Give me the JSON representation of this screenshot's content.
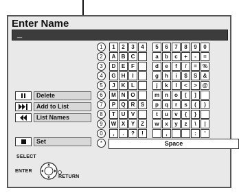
{
  "title": "Enter Name",
  "name_value": "_",
  "keyboard": {
    "rows": [
      {
        "index": "1",
        "keys": [
          "1",
          "2",
          "3",
          "4",
          "5",
          "6",
          "7",
          "8",
          "9",
          "0"
        ]
      },
      {
        "index": "2",
        "keys": [
          "A",
          "B",
          "C",
          "",
          "a",
          "b",
          "c",
          "+",
          "-",
          "="
        ]
      },
      {
        "index": "3",
        "keys": [
          "D",
          "E",
          "F",
          "",
          "d",
          "e",
          "f",
          "/",
          "=",
          "%"
        ]
      },
      {
        "index": "4",
        "keys": [
          "G",
          "H",
          "I",
          "",
          "g",
          "h",
          "i",
          "$",
          "S",
          "&"
        ]
      },
      {
        "index": "5",
        "keys": [
          "J",
          "K",
          "L",
          "",
          "j",
          "k",
          "l",
          "<",
          ">",
          "@"
        ]
      },
      {
        "index": "6",
        "keys": [
          "M",
          "N",
          "O",
          "",
          "m",
          "n",
          "o",
          "[",
          "]",
          ""
        ]
      },
      {
        "index": "7",
        "keys": [
          "P",
          "Q",
          "R",
          "S",
          "p",
          "q",
          "r",
          "s",
          "(",
          ")"
        ]
      },
      {
        "index": "8",
        "keys": [
          "T",
          "U",
          "V",
          "",
          "t",
          "u",
          "v",
          "{",
          "}",
          ""
        ]
      },
      {
        "index": "9",
        "keys": [
          "W",
          "X",
          "Y",
          "Z",
          "w",
          "x",
          "y",
          "z",
          "\\",
          "|"
        ]
      },
      {
        "index": "0",
        "keys": [
          ",",
          ".",
          "?",
          "!",
          "",
          ",",
          "",
          "",
          ":",
          "'"
        ]
      }
    ],
    "space_index": "*",
    "space_label": "Space"
  },
  "actions": {
    "delete": "Delete",
    "add_to_list": "Add to List",
    "list_names": "List Names",
    "set": "Set"
  },
  "icons": {
    "delete": "pause-icon",
    "add_to_list": "skip-forward-icon",
    "list_names": "rewind-icon",
    "set": "stop-icon"
  },
  "controls": {
    "select": "SELECT",
    "enter": "ENTER",
    "return": "RETURN"
  }
}
